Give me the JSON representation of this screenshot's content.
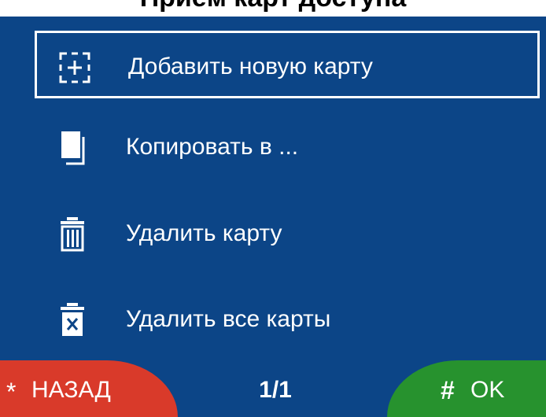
{
  "header": {
    "title": "Приём карт доступа"
  },
  "menu": {
    "items": [
      {
        "label": "Добавить новую карту",
        "icon": "add-card-icon",
        "selected": true
      },
      {
        "label": "Копировать в ...",
        "icon": "copy-icon",
        "selected": false
      },
      {
        "label": "Удалить карту",
        "icon": "trash-icon",
        "selected": false
      },
      {
        "label": "Удалить все карты",
        "icon": "delete-all-icon",
        "selected": false
      }
    ]
  },
  "footer": {
    "back_symbol": "*",
    "back_label": "НАЗАД",
    "page_indicator": "1/1",
    "ok_symbol": "#",
    "ok_label": "OK"
  },
  "colors": {
    "background": "#0c4587",
    "back_button": "#d93a2a",
    "ok_button": "#27922e",
    "text": "#ffffff"
  }
}
